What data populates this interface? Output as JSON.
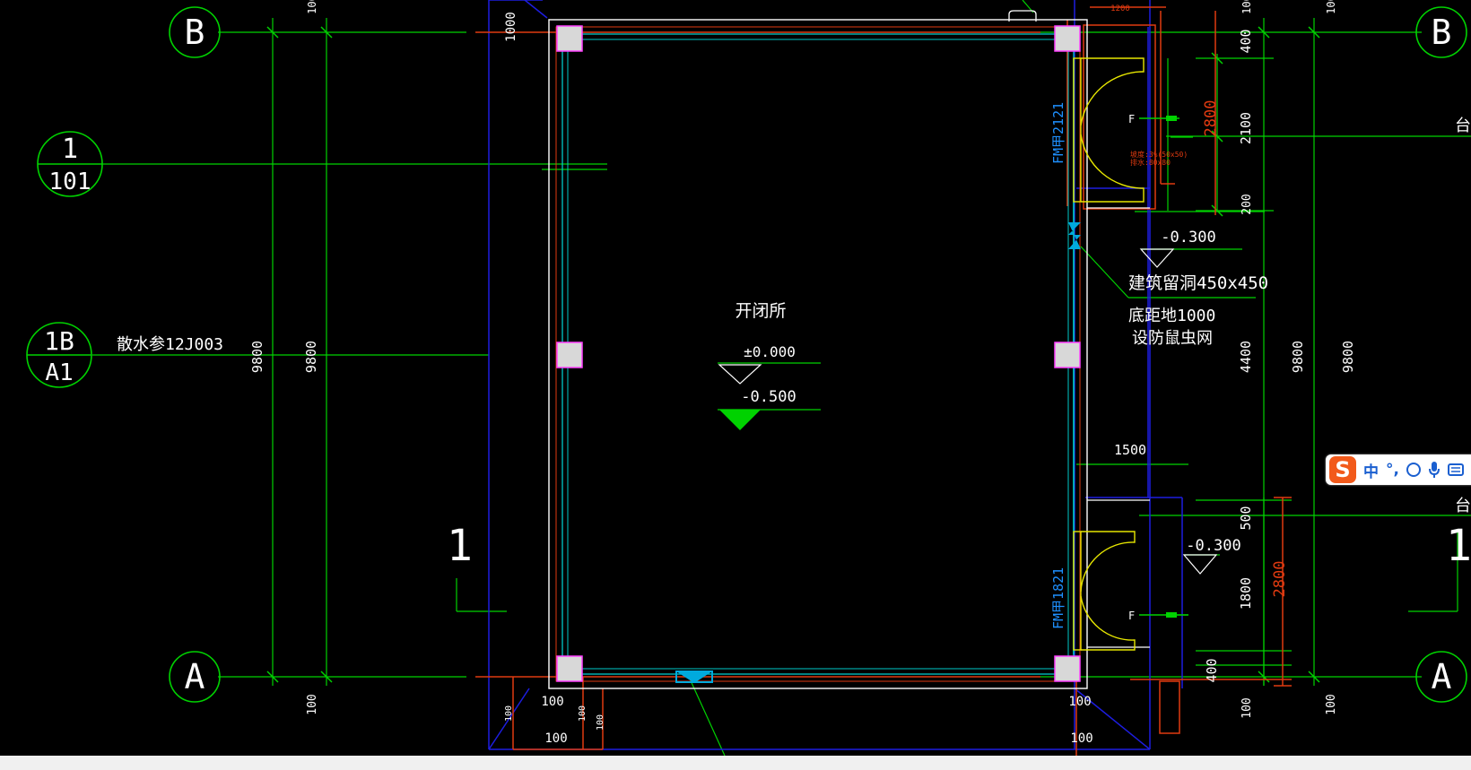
{
  "colors": {
    "background": "#000000",
    "grid": "#00d200",
    "wall": "#ffffff",
    "cyan": "#00c8c8",
    "blue": "#1d1de0",
    "red": "#e03a10",
    "yellow": "#e6e600",
    "pink": "#ff40ff",
    "tag_blue": "#1e90ff",
    "text": "#ffffff"
  },
  "grid_bubbles": {
    "b_left": "B",
    "b_right": "B",
    "a_left": "A",
    "a_right": "A",
    "section_top": "1",
    "section_bottom": "101",
    "detail_top": "1B",
    "detail_bottom": "A1"
  },
  "labels": {
    "room_name": "开闭所",
    "elev_floor": "±0.000",
    "elev_minus500": "-0.500",
    "elev_minus300_a": "-0.300",
    "elev_minus300_b": "-0.300",
    "apron_note": "散水参12J003",
    "opening_line1": "建筑留洞450x450",
    "opening_line2": "底距地1000",
    "opening_line3": "设防鼠虫网",
    "door_tag_upper": "FM甲2121",
    "door_tag_lower": "FM甲1821",
    "door_side_a": "F",
    "door_side_b": "F",
    "section_mark_left": "1",
    "section_mark_right": "1",
    "side_note_upper": "台阶",
    "side_note_lower": "台阶",
    "red_note_1": "坡度:3%(50x50)",
    "red_note_2": "排水:80x80"
  },
  "dimensions": {
    "d9800_a": "9800",
    "d9800_b": "9800",
    "d9800_c": "9800",
    "d9800_d": "9800",
    "d4400": "4400",
    "d2100": "2100",
    "d1800": "1800",
    "d2800_a": "2800",
    "d2800_b": "2800",
    "d1500": "1500",
    "d1200": "1200",
    "d400_a": "400",
    "d400_b": "400",
    "d500": "500",
    "d200": "200",
    "d1000": "1000",
    "d100_a": "100",
    "d100_b": "100",
    "d100_c": "100",
    "d100_d": "100",
    "d100_e": "100",
    "d100_f": "100",
    "d100_g": "100",
    "d100_h": "100",
    "d100_i": "100",
    "d100_j": "100",
    "d100_k": "100",
    "d100_l": "100",
    "d100_m": "100"
  },
  "ime": {
    "logo": "S",
    "mode": "中",
    "punct": "°,"
  }
}
